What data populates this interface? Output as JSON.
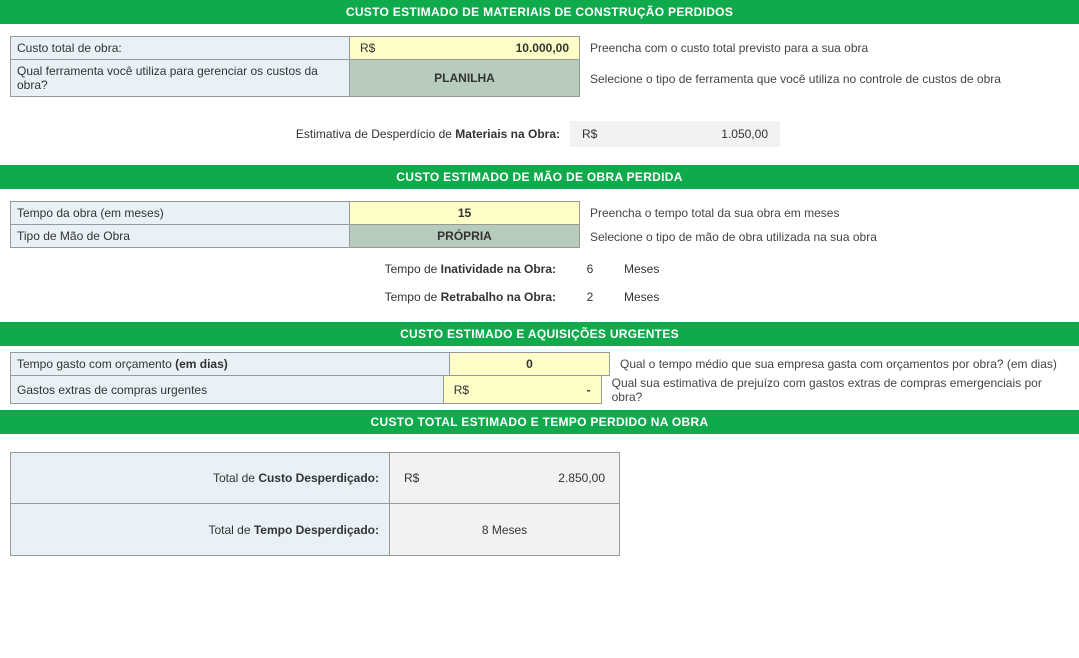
{
  "sections": {
    "materials": {
      "header": "CUSTO ESTIMADO DE MATERIAIS DE CONSTRUÇÃO PERDIDOS",
      "rows": [
        {
          "label": "Custo total de obra:",
          "currency": "R$",
          "value": "10.000,00",
          "hint": "Preencha com o custo total previsto para a sua obra"
        },
        {
          "label": "Qual ferramenta você utiliza para gerenciar os custos da obra?",
          "value": "PLANILHA",
          "hint": "Selecione o tipo de ferramenta que você utiliza no controle de custos de obra"
        }
      ],
      "estimate": {
        "label_pre": "Estimativa de Desperdício de ",
        "label_bold": "Materiais na Obra:",
        "currency": "R$",
        "value": "1.050,00"
      }
    },
    "labor": {
      "header": "CUSTO ESTIMADO DE MÃO DE OBRA PERDIDA",
      "rows": [
        {
          "label": "Tempo da obra (em meses)",
          "value": "15",
          "hint": "Preencha o tempo total da sua obra em meses"
        },
        {
          "label": "Tipo de Mão de Obra",
          "value": "PRÓPRIA",
          "hint": "Selecione o tipo de mão de obra utilizada na sua obra"
        }
      ],
      "derived": [
        {
          "pre": "Tempo de ",
          "bold": "Inatividade na Obra:",
          "value": "6",
          "unit": "Meses"
        },
        {
          "pre": "Tempo de ",
          "bold": "Retrabalho na Obra:",
          "value": "2",
          "unit": "Meses"
        }
      ]
    },
    "urgent": {
      "header": "CUSTO ESTIMADO E AQUISIÇÕES URGENTES",
      "rows": [
        {
          "label_pre": "Tempo gasto com orçamento ",
          "label_bold": "(em dias)",
          "value": "0",
          "hint": "Qual o tempo médio que sua empresa gasta com orçamentos por obra? (em dias)"
        },
        {
          "label": "Gastos extras de compras urgentes",
          "currency": "R$",
          "value": "-",
          "hint": "Qual sua estimativa de prejuízo com gastos extras de compras emergenciais por obra?"
        }
      ]
    },
    "totals": {
      "header": "CUSTO TOTAL ESTIMADO E TEMPO PERDIDO NA OBRA",
      "rows": [
        {
          "label_pre": "Total de ",
          "label_bold": "Custo Desperdiçado:",
          "currency": "R$",
          "value": "2.850,00"
        },
        {
          "label_pre": "Total de ",
          "label_bold": "Tempo Desperdiçado:",
          "value": "8 Meses"
        }
      ]
    }
  }
}
